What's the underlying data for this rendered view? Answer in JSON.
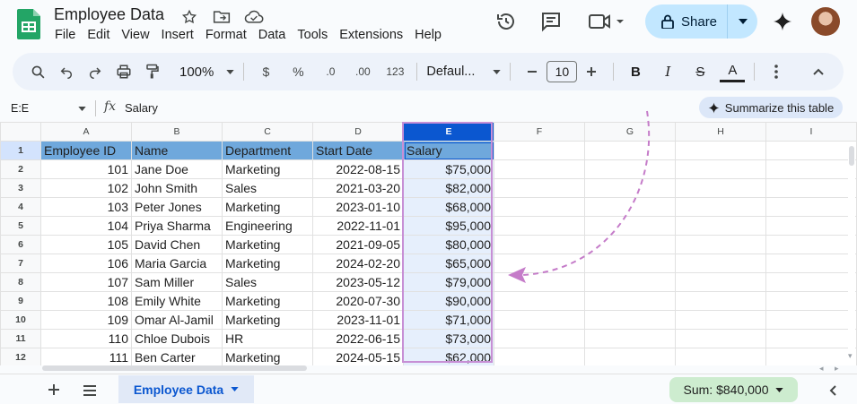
{
  "app": {
    "title": "Employee Data",
    "menu": [
      "File",
      "Edit",
      "View",
      "Insert",
      "Format",
      "Data",
      "Tools",
      "Extensions",
      "Help"
    ],
    "share_label": "Share"
  },
  "toolbar": {
    "zoom": "100%",
    "currency": "$",
    "percent": "%",
    "decrease_decimal": ".0",
    "increase_decimal": ".00",
    "number_format": "123",
    "font": "Defaul...",
    "font_size": "10",
    "bold": "B",
    "italic": "I",
    "strike": "S",
    "text_color": "A"
  },
  "formula_bar": {
    "name_box": "E:E",
    "fx": "fx",
    "value": "Salary",
    "summarize_label": "Summarize this table"
  },
  "grid": {
    "columns": [
      "A",
      "B",
      "C",
      "D",
      "E",
      "F",
      "G",
      "H",
      "I"
    ],
    "row_numbers": [
      "1",
      "2",
      "3",
      "4",
      "5",
      "6",
      "7",
      "8",
      "9",
      "10",
      "11",
      "12"
    ],
    "header": [
      "Employee ID",
      "Name",
      "Department",
      "Start Date",
      "Salary"
    ],
    "rows": [
      [
        "101",
        "Jane Doe",
        "Marketing",
        "2022-08-15",
        "$75,000"
      ],
      [
        "102",
        "John Smith",
        "Sales",
        "2021-03-20",
        "$82,000"
      ],
      [
        "103",
        "Peter Jones",
        "Marketing",
        "2023-01-10",
        "$68,000"
      ],
      [
        "104",
        "Priya Sharma",
        "Engineering",
        "2022-11-01",
        "$95,000"
      ],
      [
        "105",
        "David Chen",
        "Marketing",
        "2021-09-05",
        "$80,000"
      ],
      [
        "106",
        "Maria Garcia",
        "Marketing",
        "2024-02-20",
        "$65,000"
      ],
      [
        "107",
        "Sam Miller",
        "Sales",
        "2023-05-12",
        "$79,000"
      ],
      [
        "108",
        "Emily White",
        "Marketing",
        "2020-07-30",
        "$90,000"
      ],
      [
        "109",
        "Omar Al-Jamil",
        "Marketing",
        "2023-11-01",
        "$71,000"
      ],
      [
        "110",
        "Chloe Dubois",
        "HR",
        "2022-06-15",
        "$73,000"
      ],
      [
        "111",
        "Ben Carter",
        "Marketing",
        "2024-05-15",
        "$62,000"
      ]
    ]
  },
  "bottom": {
    "sheet_tab": "Employee Data",
    "sum": "Sum: $840,000"
  },
  "colors": {
    "accent": "#0b57d0",
    "share_bg": "#c2e7ff",
    "header_fill": "#6fa8dc",
    "selection_outline": "#c78fd5",
    "sum_bg": "#cdeccf"
  },
  "icons": [
    "sheets-logo-icon",
    "star-icon",
    "move-folder-icon",
    "cloud-icon",
    "history-icon",
    "comment-icon",
    "meet-icon",
    "lock-icon",
    "gemini-spark-icon",
    "search-icon",
    "undo-icon",
    "redo-icon",
    "print-icon",
    "paint-format-icon",
    "more-icon",
    "collapse-icon",
    "add-sheet-icon",
    "all-sheets-icon",
    "explore-icon"
  ]
}
